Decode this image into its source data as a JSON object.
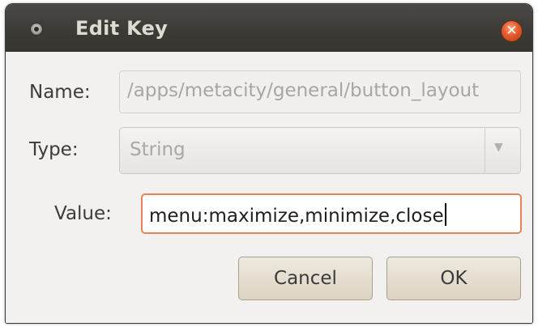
{
  "window": {
    "title": "Edit Key",
    "close_glyph": "✕"
  },
  "form": {
    "name_label": "Name:",
    "name_value": "/apps/metacity/general/button_layout",
    "type_label": "Type:",
    "type_value": "String",
    "type_arrow": "▼",
    "value_label": "Value:",
    "value_text": "menu:maximize,minimize,close"
  },
  "buttons": {
    "cancel_label": "Cancel",
    "ok_label": "OK"
  },
  "colors": {
    "titlebar": "#3c3b37",
    "focus_border": "#e9825b",
    "close_button": "#e45a2c"
  },
  "icons": {
    "window_menu": "window-menu-icon",
    "close": "close-icon",
    "dropdown": "dropdown-arrow-icon"
  }
}
